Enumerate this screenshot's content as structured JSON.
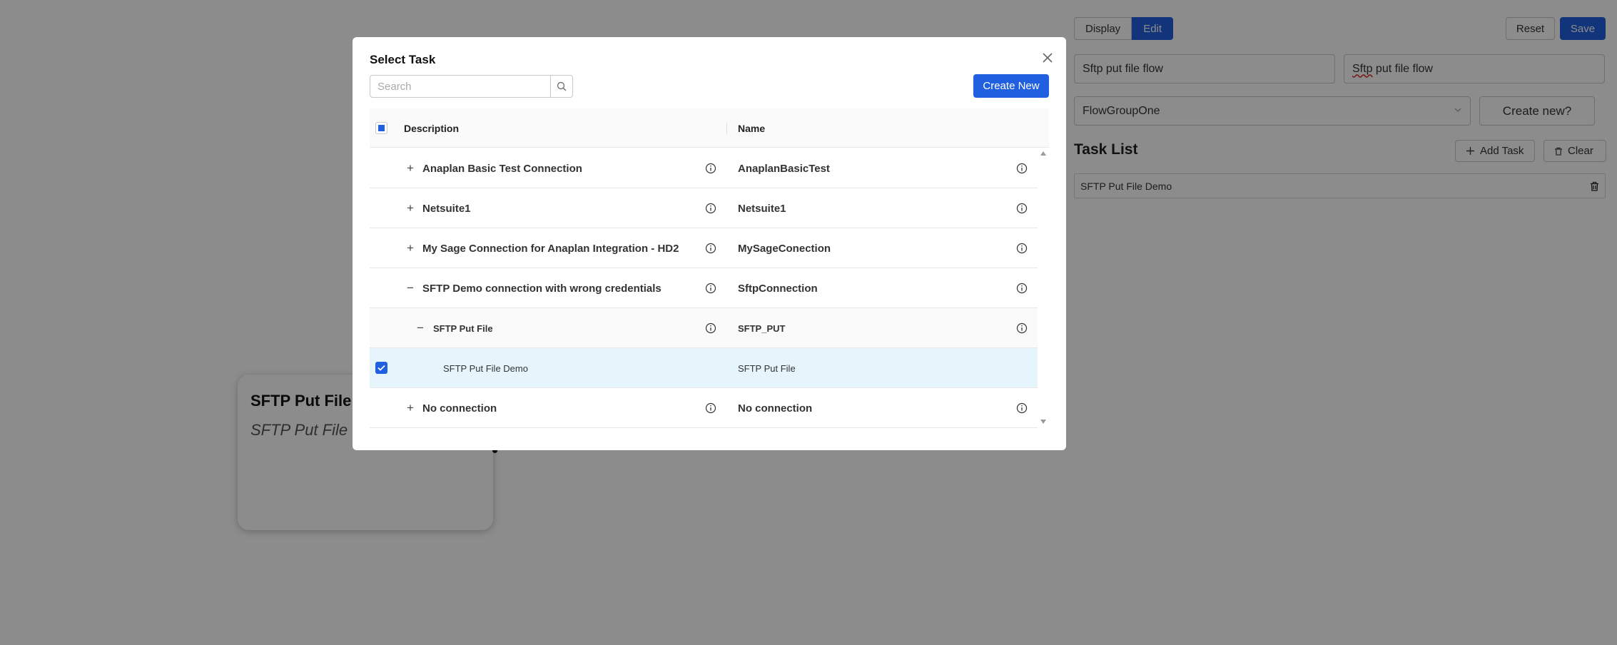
{
  "background": {
    "canvas_card": {
      "title": "SFTP Put File",
      "subtitle": "SFTP Put File"
    },
    "right_panel": {
      "mode_tabs": [
        {
          "label": "Display",
          "active": false
        },
        {
          "label": "Edit",
          "active": true
        }
      ],
      "reset_label": "Reset",
      "save_label": "Save",
      "flow_id_value": "Sftp put file flow",
      "flow_name_word1": "Sftp",
      "flow_name_rest": " put file flow",
      "flow_group_value": "FlowGroupOne",
      "create_new_label": "Create new?",
      "task_list_title": "Task List",
      "add_task_label": "Add Task",
      "clear_label": "Clear",
      "tasks": [
        {
          "label": "SFTP Put File Demo"
        }
      ]
    }
  },
  "modal": {
    "title": "Select Task",
    "search_placeholder": "Search",
    "create_button_label": "Create New",
    "columns": {
      "description": "Description",
      "name": "Name"
    },
    "rows": [
      {
        "description": "Anaplan Basic Test Connection",
        "name": "AnaplanBasicTest",
        "level": 0,
        "toggle": "+"
      },
      {
        "description": "Netsuite1",
        "name": "Netsuite1",
        "level": 0,
        "toggle": "+"
      },
      {
        "description": "My Sage Connection for Anaplan Integration - HD2",
        "name": "MySageConection",
        "level": 0,
        "toggle": "+"
      },
      {
        "description": "SFTP Demo connection with wrong credentials",
        "name": "SftpConnection",
        "level": 0,
        "toggle": "−"
      },
      {
        "description": "SFTP Put File",
        "name": "SFTP_PUT",
        "level": 1,
        "toggle": "−"
      },
      {
        "description": "SFTP Put File Demo",
        "name": "SFTP Put File",
        "level": 2,
        "toggle": "",
        "checked": true
      },
      {
        "description": "No connection",
        "name": "No connection",
        "level": 0,
        "toggle": "+"
      }
    ]
  },
  "colors": {
    "primary": "#1f5fe0",
    "selected_row": "#e6f4fb",
    "overlay": "rgba(0,0,0,0.45)"
  },
  "icons": [
    "close-icon",
    "search-icon",
    "plus-icon",
    "minus-icon",
    "info-icon",
    "checkbox-checked-icon",
    "trash-icon",
    "chevron-down-icon",
    "scroll-up-icon",
    "scroll-down-icon"
  ]
}
